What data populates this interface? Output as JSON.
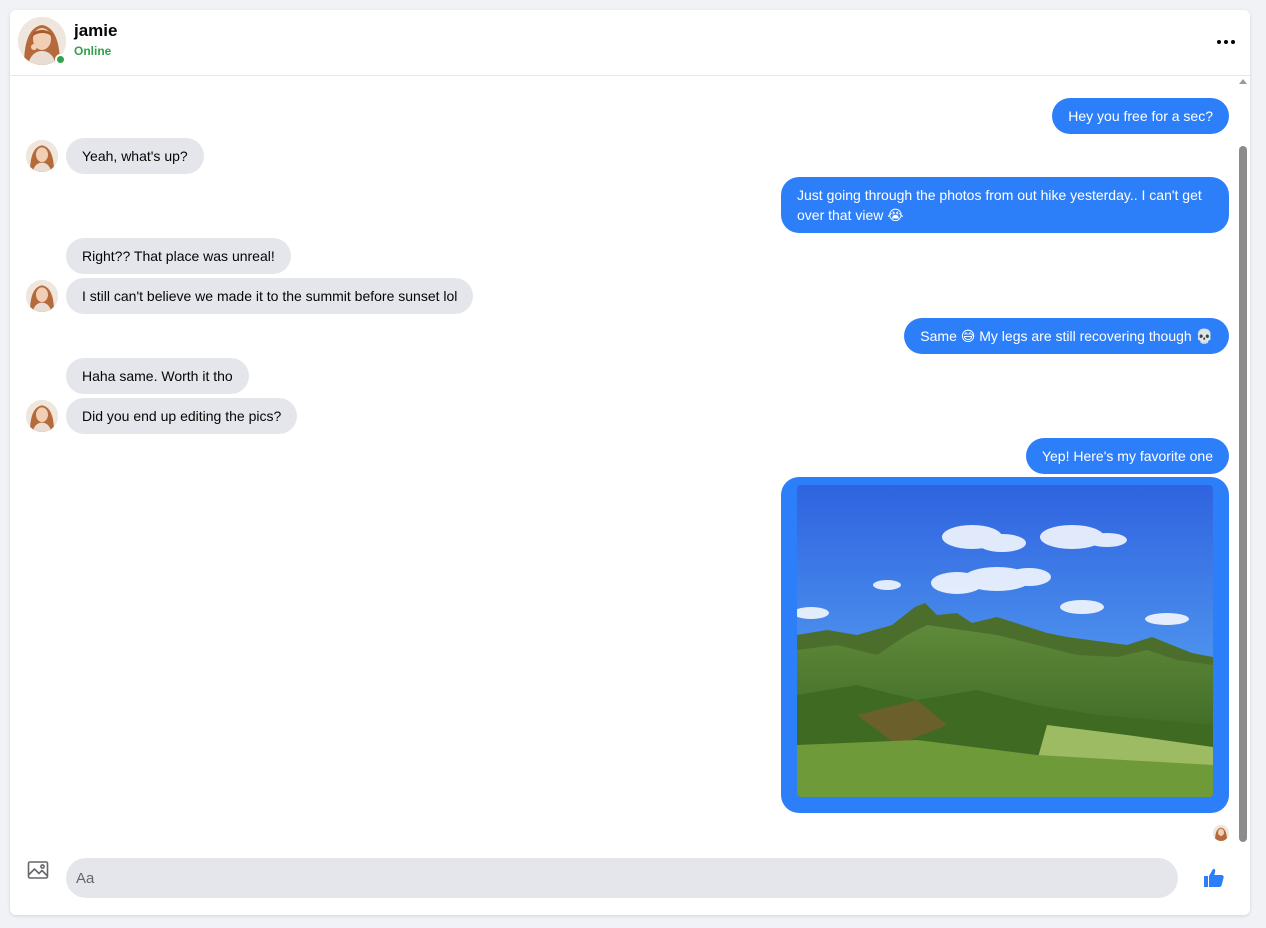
{
  "colors": {
    "accent": "#2d7ff9",
    "online": "#31a24c",
    "incoming_bubble": "#e4e6eb"
  },
  "header": {
    "contact_name": "jamie",
    "status": "Online",
    "more_icon": "more-horizontal-icon"
  },
  "messages": [
    {
      "direction": "outgoing",
      "text": "Hey you free for a sec?"
    },
    {
      "direction": "incoming",
      "text": "Yeah, what's up?",
      "show_avatar": true
    },
    {
      "direction": "outgoing",
      "text": "Just going through the photos from out hike yesterday.. I can't get over that view 😭"
    },
    {
      "direction": "incoming",
      "text": "Right?? That place was unreal!",
      "show_avatar": false
    },
    {
      "direction": "incoming",
      "text": "I still can't believe we made it to the summit before sunset lol",
      "show_avatar": true
    },
    {
      "direction": "outgoing",
      "text": "Same 😅 My legs are still recovering though 💀"
    },
    {
      "direction": "incoming",
      "text": "Haha same. Worth it tho",
      "show_avatar": false
    },
    {
      "direction": "incoming",
      "text": "Did you end up editing the pics?",
      "show_avatar": true
    },
    {
      "direction": "outgoing",
      "text": "Yep! Here's my favorite one"
    },
    {
      "direction": "outgoing",
      "type": "image",
      "image": "mountain-landscape-photo"
    }
  ],
  "read_receipt": {
    "icon": "seen-avatar"
  },
  "composer": {
    "placeholder": "Aa",
    "value": "",
    "attach_icon": "image-icon",
    "send_icon": "thumbs-up-icon"
  }
}
